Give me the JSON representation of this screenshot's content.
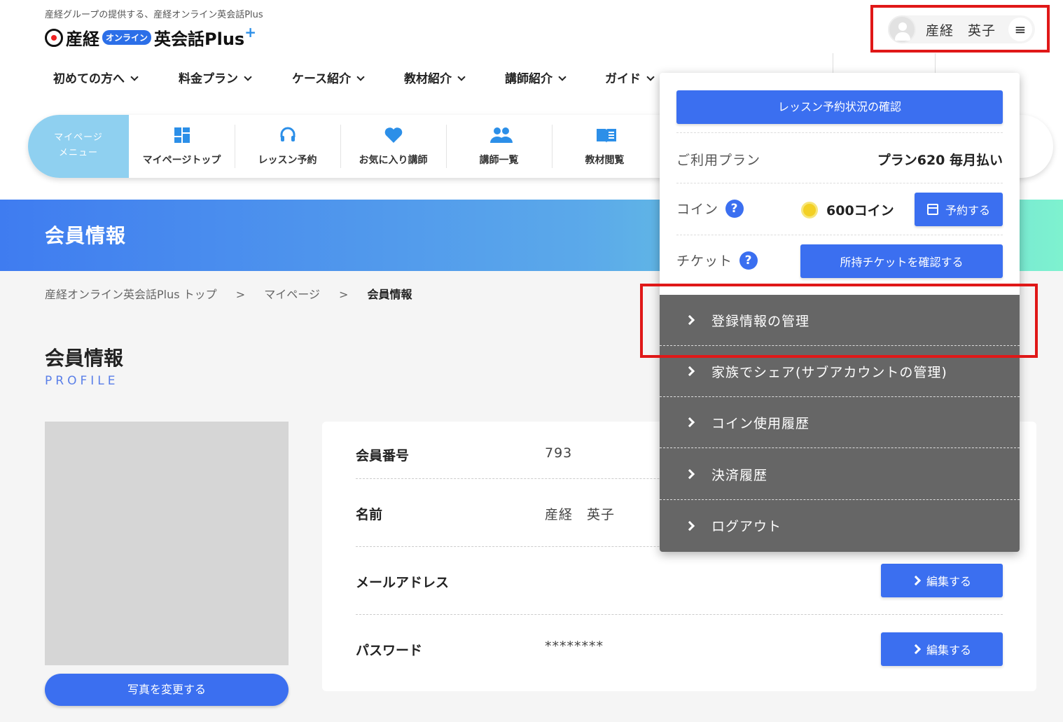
{
  "header": {
    "tagline": "産経グループの提供する、産経オンライン英会話Plus",
    "logo": {
      "text1": "産経",
      "badge": "オンライン",
      "text2": "英会話Plus",
      "plus": "+"
    },
    "user_name": "産経　英子",
    "menu_icon": "≡"
  },
  "top_nav": [
    {
      "label": "初めての方へ"
    },
    {
      "label": "料金プラン"
    },
    {
      "label": "ケース紹介"
    },
    {
      "label": "教材紹介"
    },
    {
      "label": "講師紹介"
    },
    {
      "label": "ガイド"
    }
  ],
  "mypage_menu": {
    "label_line1": "マイページ",
    "label_line2": "メニュー",
    "items": [
      {
        "label": "マイページトップ",
        "icon": "dashboard-icon"
      },
      {
        "label": "レッスン予約",
        "icon": "headset-icon"
      },
      {
        "label": "お気に入り講師",
        "icon": "heart-icon"
      },
      {
        "label": "講師一覧",
        "icon": "people-icon"
      },
      {
        "label": "教材閲覧",
        "icon": "book-icon"
      }
    ]
  },
  "banner": {
    "title": "会員情報"
  },
  "breadcrumb": {
    "items": [
      "産経オンライン英会話Plus トップ",
      "マイページ",
      "会員情報"
    ],
    "separator": ">"
  },
  "page": {
    "title": "会員情報",
    "subtitle": "PROFILE"
  },
  "photo": {
    "change_button": "写真を変更する"
  },
  "profile": {
    "rows": [
      {
        "key": "会員番号",
        "value": "793"
      },
      {
        "key": "名前",
        "value": "産経　英子"
      },
      {
        "key": "メールアドレス",
        "value": "",
        "button": "編集する"
      },
      {
        "key": "パスワード",
        "value": "********",
        "button": "編集する"
      }
    ]
  },
  "dropdown": {
    "reserve_status_button": "レッスン予約状況の確認",
    "plan_label": "ご利用プラン",
    "plan_value": "プラン620 毎月払い",
    "coin_label": "コイン",
    "coin_value": "600コイン",
    "reserve_button": "予約する",
    "ticket_label": "チケット",
    "ticket_button": "所持チケットを確認する",
    "help_mark": "?",
    "menu": [
      {
        "label": "登録情報の管理"
      },
      {
        "label": "家族でシェア(サブアカウントの管理)"
      },
      {
        "label": "コイン使用履歴"
      },
      {
        "label": "決済履歴"
      },
      {
        "label": "ログアウト"
      }
    ]
  },
  "colors": {
    "primary": "#3b6ff0",
    "highlight": "#e01818",
    "menu_bg": "#666666",
    "mypage_label_bg": "#8fd0f0"
  }
}
